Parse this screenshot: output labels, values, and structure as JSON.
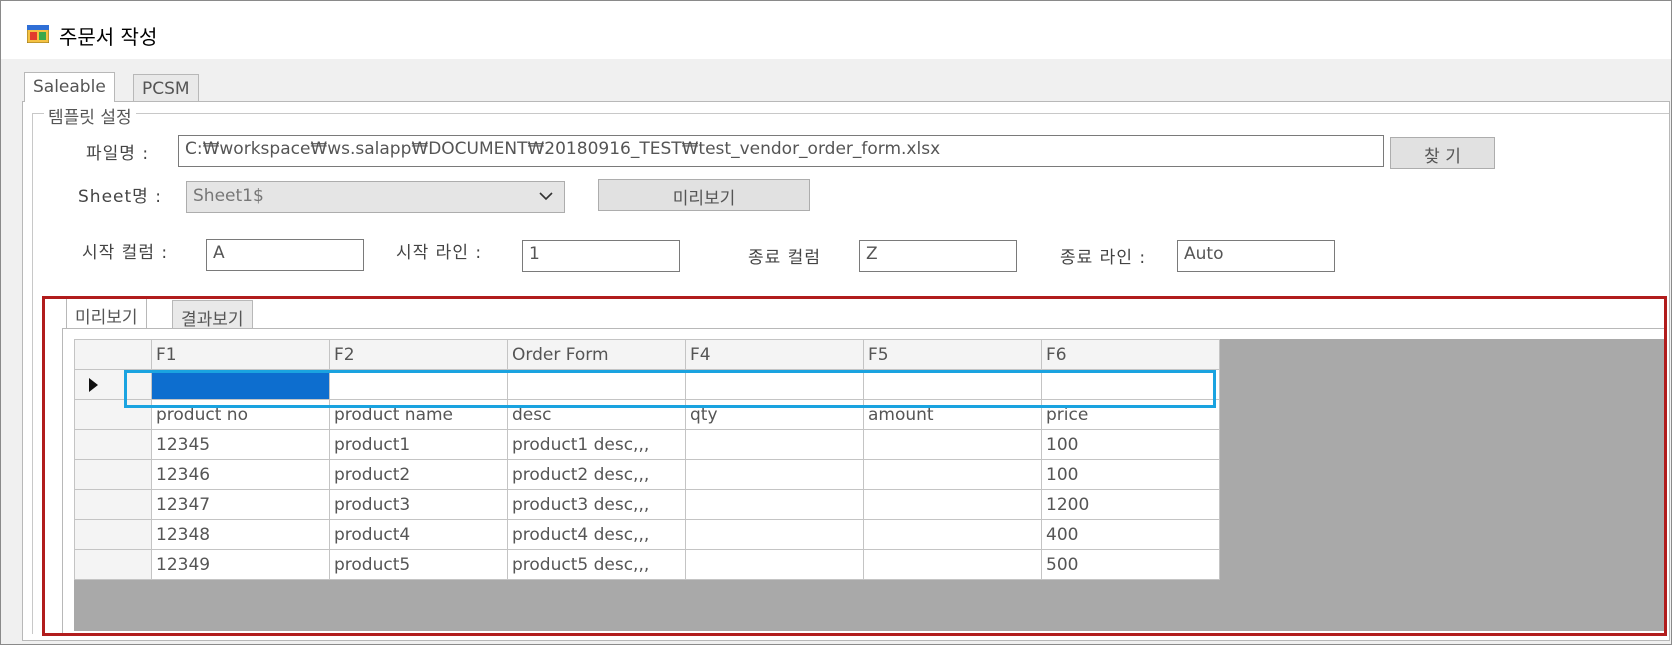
{
  "window": {
    "title": "주문서 작성",
    "icon": "app-window-icon"
  },
  "outer_tabs": [
    {
      "label": "Saleable",
      "active": true
    },
    {
      "label": "PCSM",
      "active": false
    }
  ],
  "group": {
    "title": "템플릿 설정"
  },
  "form": {
    "file_label": "파일명 :",
    "file_path": "C:₩workspace₩ws.salapp₩DOCUMENT₩20180916_TEST₩test_vendor_order_form.xlsx",
    "browse_button": "찾 기",
    "sheet_label": "Sheet명 :",
    "sheet_value": "Sheet1$",
    "preview_button": "미리보기",
    "start_col_label": "시작 컬럼 :",
    "start_col_value": "A",
    "start_line_label": "시작 라인 :",
    "start_line_value": "1",
    "end_col_label": "종료 컬럼",
    "end_col_value": "Z",
    "end_line_label": "종료 라인 :",
    "end_line_value": "Auto"
  },
  "inner_tabs": [
    {
      "label": "미리보기",
      "active": true
    },
    {
      "label": "결과보기",
      "active": false
    }
  ],
  "grid": {
    "columns": [
      "F1",
      "F2",
      "Order Form",
      "F4",
      "F5",
      "F6"
    ],
    "rows": [
      [
        "",
        "",
        "",
        "",
        "",
        ""
      ],
      [
        "product no",
        "product name",
        "desc",
        "qty",
        "amount",
        "price"
      ],
      [
        "12345",
        "product1",
        "product1 desc,,,",
        "",
        "",
        "100"
      ],
      [
        "12346",
        "product2",
        "product2 desc,,,",
        "",
        "",
        "100"
      ],
      [
        "12347",
        "product3",
        "product3 desc,,,",
        "",
        "",
        "1200"
      ],
      [
        "12348",
        "product4",
        "product4 desc,,,",
        "",
        "",
        "400"
      ],
      [
        "12349",
        "product5",
        "product5 desc,,,",
        "",
        "",
        "500"
      ]
    ]
  },
  "colors": {
    "highlight_red": "#b11c1c",
    "highlight_blue": "#1aa3e0",
    "selection": "#0d6ecf"
  }
}
